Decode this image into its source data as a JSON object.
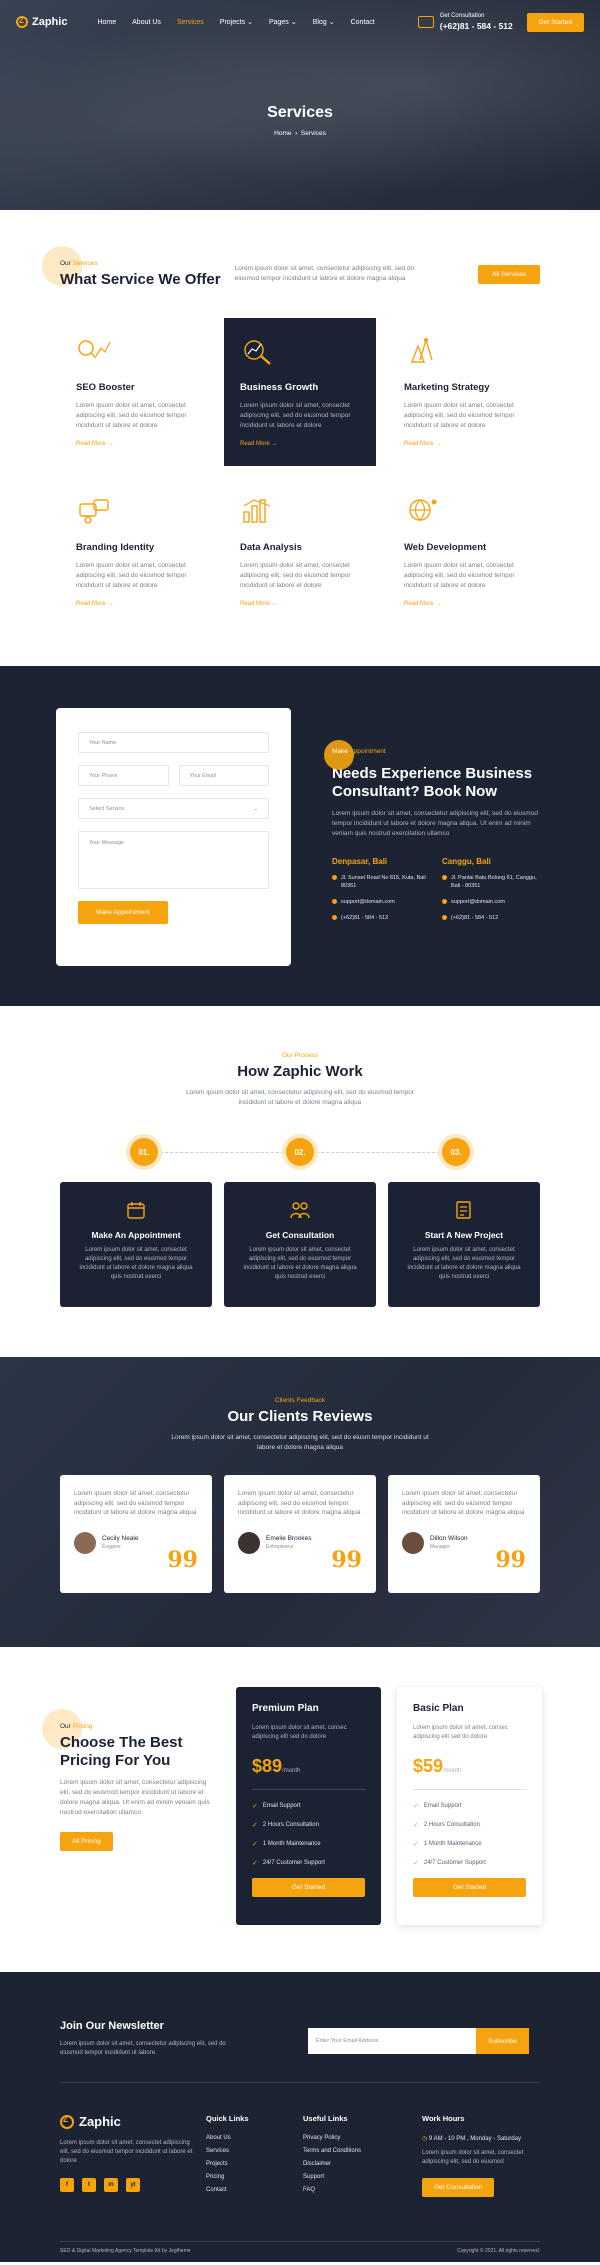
{
  "brand": {
    "name": "Zaphic"
  },
  "nav": {
    "items": [
      "Home",
      "About Us",
      "Services",
      "Projects",
      "Pages",
      "Blog",
      "Contact"
    ],
    "consult_label": "Get Consultation",
    "phone": "(+62)81 - 584 - 512",
    "cta": "Get Started"
  },
  "hero": {
    "title": "Services",
    "crumb_home": "Home",
    "crumb_current": "Services"
  },
  "services": {
    "tag_prefix": "Our",
    "tag_accent": "Services",
    "title": "What Service We Offer",
    "desc": "Lorem ipsum dolor sit amet, consectetur adipiscing elit, sed do eiusmod tempor incididunt ut labore et dolore magna aliqua",
    "button": "All Services",
    "read_more": "Read More",
    "items": [
      {
        "title": "SEO Booster",
        "text": "Lorem ipsum dolor sit amet, consectet adipiscing elit, sed do eiusmod tempor incididunt ut labore et dolore"
      },
      {
        "title": "Business Growth",
        "text": "Lorem ipsum dolor sit amet, consectet adipiscing elit, sed do eiusmod tempor incididunt ut labore et dolore"
      },
      {
        "title": "Marketing Strategy",
        "text": "Lorem ipsum dolor sit amet, consectet adipiscing elit, sed do eiusmod tempor incididunt ut labore et dolore"
      },
      {
        "title": "Branding Identity",
        "text": "Lorem ipsum dolor sit amet, consectet adipiscing elit, sed do eiusmod tempor incididunt ut labore et dolore"
      },
      {
        "title": "Data Analysis",
        "text": "Lorem ipsum dolor sit amet, consectet adipiscing elit, sed do eiusmod tempor incididunt ut labore et dolore"
      },
      {
        "title": "Web Development",
        "text": "Lorem ipsum dolor sit amet, consectet adipiscing elit, sed do eiusmod tempor incididunt ut labore et dolore"
      }
    ]
  },
  "appointment": {
    "form": {
      "name": "Your Name",
      "phone": "Your Phone",
      "email": "Your Email",
      "service": "Select Service",
      "message": "Your Message",
      "submit": "Make Appointment"
    },
    "tag_accent": "Make",
    "tag_rest": "Appointment",
    "title": "Needs Experience Business Consultant? Book Now",
    "text": "Lorem ipsum dolor sit amet, consectetur adipiscing elit, sed do eiusmod tempor incididunt ut labore et dolore magna aliqua. Ut enim ad minim veniam quis nostrud exercitation ullamco",
    "locations": [
      {
        "city": "Denpasar, Bali",
        "address": "Jl. Sunset Road No 815, Kuta, Bali 80361",
        "email": "support@domain.com",
        "phone": "(+62)81 - 584 - 512"
      },
      {
        "city": "Canggu, Bali",
        "address": "Jl. Pantai Batu Bolong 61, Canggu, Bali - 80351",
        "email": "support@domain.com",
        "phone": "(+62)81 - 584 - 512"
      }
    ]
  },
  "process": {
    "tag": "Our Process",
    "title": "How Zaphic Work",
    "lead": "Lorem ipsum dolor sit amet, consectetur adipiscing elit, sed do eiusmod tempor incididunt ut labore et dolore magna aliqua",
    "steps": [
      {
        "num": "01.",
        "title": "Make An Appointment",
        "text": "Lorem ipsum dolor sit amet, consectet adipiscing elit, sed do eiusmod tempor incididunt ut labore et dolore magna aliqua quis nostrud exerci"
      },
      {
        "num": "02.",
        "title": "Get Consultation",
        "text": "Lorem ipsum dolor sit amet, consectet adipiscing elit, sed do eiusmod tempor incididunt ut labore et dolore magna aliqua quis nostrud exerci"
      },
      {
        "num": "03.",
        "title": "Start A New Project",
        "text": "Lorem ipsum dolor sit amet, consectet adipiscing elit, sed do eiusmod tempor incididunt ut labore et dolore magna aliqua quis nostrud exerci"
      }
    ]
  },
  "reviews": {
    "tag": "Clients Feedback",
    "title": "Our Clients Reviews",
    "lead": "Lorem ipsum dolor sit amet, consectetur adipiscing elit, sed do eiusm tempor incididunt ut labore et dolore magna aliqua",
    "items": [
      {
        "text": "Lorem ipsum dolor sit amet, consectetur adipiscing elit, sed do eiusmod tempor incididunt ut labore et dolore magna aliqua",
        "name": "Cecily Neale",
        "role": "Enggeer"
      },
      {
        "text": "Lorem ipsum dolor sit amet, consectetur adipiscing elit, sed do eiusmod tempor incididunt ut labore et dolore magna aliqua",
        "name": "Emelie Brookes",
        "role": "Entrepeneur"
      },
      {
        "text": "Lorem ipsum dolor sit amet, consectetur adipiscing elit, sed do eiusmod tempor incididunt ut labore et dolore magna aliqua",
        "name": "Dillon Wilson",
        "role": "Manager"
      }
    ]
  },
  "pricing": {
    "tag_prefix": "Our",
    "tag_accent": "Pricing",
    "title": "Choose The Best Pricing For You",
    "text": "Lorem ipsum dolor sit amet, consectetur adipiscing elit, sed do eiusmod tempor incididunt ut labore et dolore magna aliqua. Ut enim ad minim veniam quis nostrud exercitation ullamco",
    "button": "All Pricing",
    "plans": [
      {
        "name": "Premium Plan",
        "desc": "Lorem ipsum dolor sit amet, consec adipiscing elit sed do dolore",
        "price": "$89",
        "per": "/month",
        "features": [
          "Email Support",
          "2 Hours Consultation",
          "1 Month Maintenance",
          "24/7 Customer Support"
        ],
        "cta": "Get Started"
      },
      {
        "name": "Basic Plan",
        "desc": "Lorem ipsum dolor sit amet, consec adipiscing elit sed do dolore",
        "price": "$59",
        "per": "/month",
        "features": [
          "Email Support",
          "2 Hours Consultation",
          "1 Month Maintenance",
          "24/7 Customer Support"
        ],
        "cta": "Get Started"
      }
    ]
  },
  "newsletter": {
    "title": "Join Our Newsletter",
    "text": "Lorem ipsum dolor sit amet, consectetur adipiscing elit, sed do eiusmod tempor incididunt ut labore",
    "placeholder": "Enter Your Email Address",
    "button": "Subscribe"
  },
  "footer": {
    "about": "Lorem ipsum dolor sit amet, consectet adipiscing elit, sed do eiusmod tempor incididunt ut labore et dolore",
    "quick_links_title": "Quick Links",
    "quick_links": [
      "About Us",
      "Services",
      "Projects",
      "Pricing",
      "Contact"
    ],
    "useful_links_title": "Useful Links",
    "useful_links": [
      "Privacy Policy",
      "Terms and Conditions",
      "Disclaimer",
      "Support",
      "FAQ"
    ],
    "hours_title": "Work Hours",
    "hours": "9 AM - 10 PM , Monday - Saturday",
    "hours_text": "Lorem ipsum dolor sit amet, consectet adipiscing elit, sed do eiusmod",
    "hours_button": "Get Consultation",
    "socials": [
      "f",
      "t",
      "in",
      "yt"
    ],
    "copyright_left": "SEO & Digital Marketing Agency Template Kit by Jegtheme",
    "copyright_right": "Copyright © 2021. All rights reserved."
  }
}
